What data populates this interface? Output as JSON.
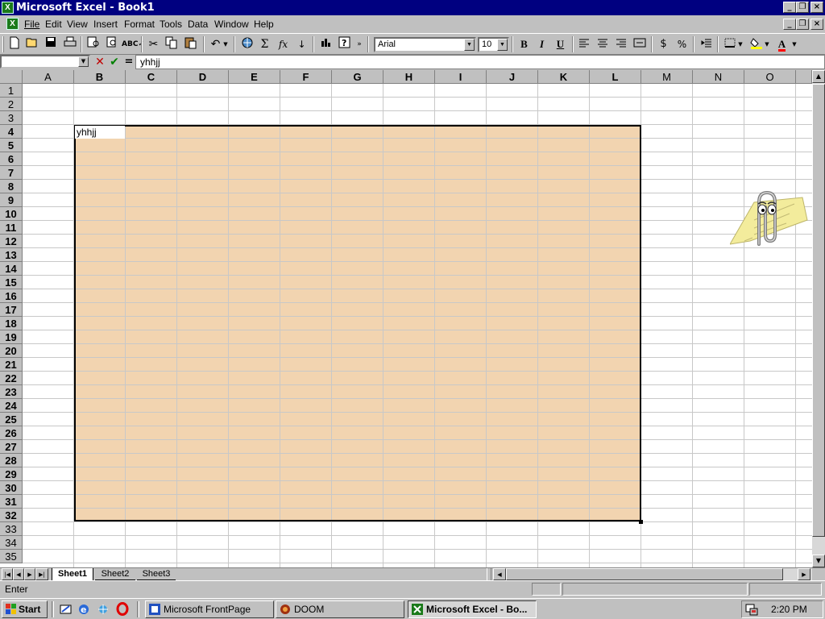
{
  "window": {
    "title": "Microsoft Excel - Book1",
    "app_icon": "excel-icon"
  },
  "menu": [
    "File",
    "Edit",
    "View",
    "Insert",
    "Format",
    "Tools",
    "Data",
    "Window",
    "Help"
  ],
  "toolbar": {
    "font": "Arial",
    "size": "10",
    "bold": "B",
    "italic": "I",
    "underline": "U",
    "sigma": "Σ",
    "fx": "fx",
    "percent": "%"
  },
  "formula": {
    "name_box": "",
    "equals": "=",
    "content": "yhhjj",
    "cancel_icon": "cancel-x-icon",
    "enter_icon": "enter-check-icon"
  },
  "columns": [
    "A",
    "B",
    "C",
    "D",
    "E",
    "F",
    "G",
    "H",
    "I",
    "J",
    "K",
    "L",
    "M",
    "N",
    "O"
  ],
  "rows": [
    "1",
    "2",
    "3",
    "4",
    "5",
    "6",
    "7",
    "8",
    "9",
    "10",
    "11",
    "12",
    "13",
    "14",
    "15",
    "16",
    "17",
    "18",
    "19",
    "20",
    "21",
    "22",
    "23",
    "24",
    "25",
    "26",
    "27",
    "28",
    "29",
    "30",
    "31",
    "32",
    "33",
    "34",
    "35"
  ],
  "selection": {
    "range": "B4:L32",
    "fill": "#f2d4b0",
    "active_cell": "B4",
    "active_cell_text": "yhhjj"
  },
  "sheets": [
    "Sheet1",
    "Sheet2",
    "Sheet3"
  ],
  "status": {
    "mode": "Enter"
  },
  "taskbar": {
    "start": "Start",
    "clock": "2:20 PM",
    "tasks": [
      "Microsoft FrontPage",
      "DOOM",
      "Microsoft Excel - Bo..."
    ]
  },
  "assistant": {
    "name": "paperclip-assistant"
  }
}
